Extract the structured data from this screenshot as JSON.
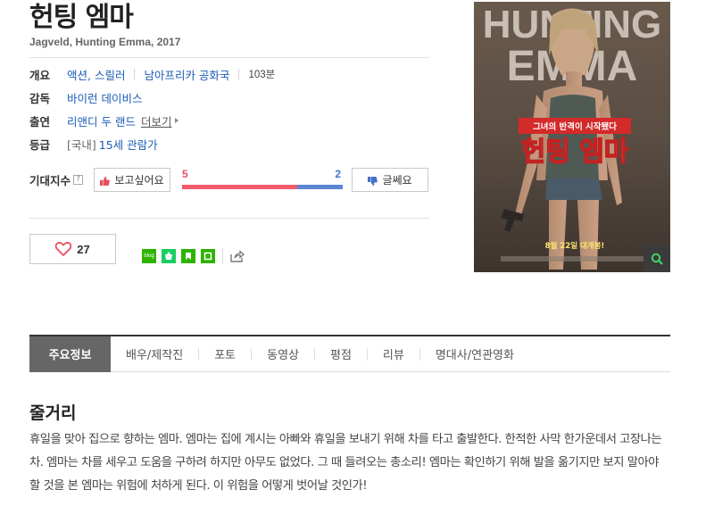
{
  "movie": {
    "title": "헌팅 엠마",
    "original_title": "Jagveld, Hunting Emma, 2017"
  },
  "info": {
    "genre_label": "개요",
    "genres": "액션, 스릴러",
    "country": "남아프리카 공화국",
    "runtime": "103분",
    "director_label": "감독",
    "director": "바이런 데이비스",
    "cast_label": "출연",
    "cast": "리앤디 두 랜드",
    "cast_more": "더보기",
    "rating_label": "등급",
    "rating_region": "[국내]",
    "rating": "15세 관람가"
  },
  "expectation": {
    "label": "기대지수",
    "help": "?",
    "want_label": "보고싶어요",
    "no_label": "글쎄요",
    "want_count": "5",
    "no_count": "2",
    "want_fraction": 0.714
  },
  "like": {
    "count": "27"
  },
  "share": {
    "blog_text": "blog",
    "icons": [
      "blog-icon",
      "band-icon",
      "keep-icon",
      "memo-icon",
      "share-icon"
    ]
  },
  "tabs": [
    "주요정보",
    "배우/제작진",
    "포토",
    "동영상",
    "평점",
    "리뷰",
    "명대사/연관영화"
  ],
  "story": {
    "heading": "줄거리",
    "text": "휴일을 맞아 집으로 향하는 엠마. 엠마는 집에 계시는 아빠와 휴일을 보내기 위해 차를 타고 출발한다. 한적한 사막 한가운데서 고장나는 차. 엠마는 차를 세우고 도움을 구하려 하지만 아무도 없었다. 그 때 들려오는 총소리! 엠마는 확인하기 위해 발을 옮기지만 보지 말아야 할 것을 본 엠마는 위험에 처하게 된다. 이 위험을 어떻게 벗어날 것인가!"
  },
  "poster": {
    "top_text_1": "HUNTING",
    "top_text_2": "EMMA",
    "tagline": "그녀의 반격이 시작됐다",
    "title": "헌팅 엠마",
    "release": "8월 22일 대개봉!"
  },
  "colors": {
    "like_red": "#e84f5e",
    "dislike_blue": "#4472c4",
    "naver_green": "#2db400",
    "link_blue": "#1a5bb5"
  }
}
